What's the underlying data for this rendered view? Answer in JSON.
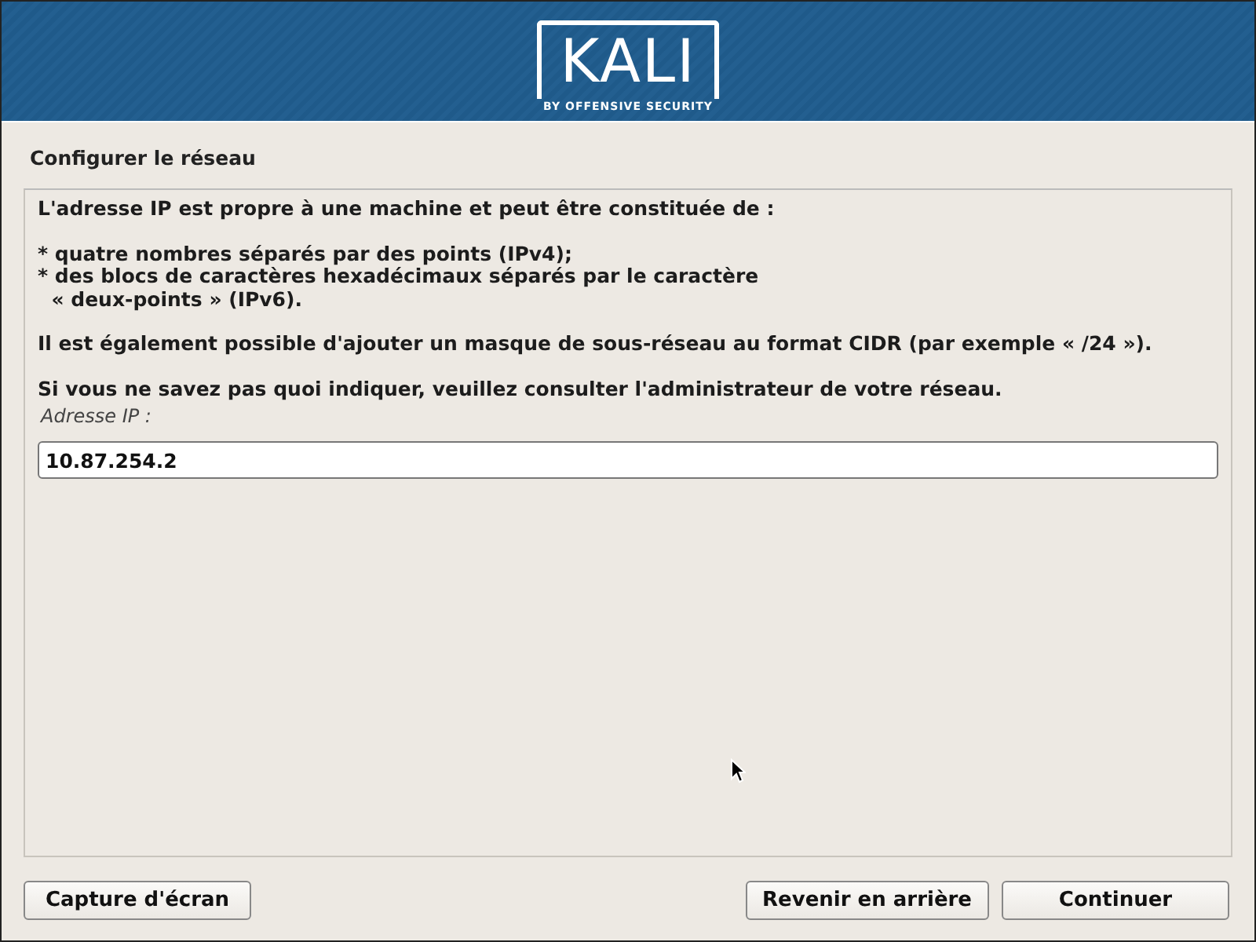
{
  "banner": {
    "logo_text": "KALI",
    "logo_tagline": "BY OFFENSIVE SECURITY"
  },
  "title": "Configurer le réseau",
  "intro": "L'adresse IP est propre à une machine et peut être constituée de :",
  "bullets": [
    {
      "text": "* quatre nombres séparés par des points (IPv4);"
    },
    {
      "text": "* des blocs de caractères hexadécimaux séparés par le caractère\n  « deux-points » (IPv6)."
    }
  ],
  "paragraphs": [
    "Il est également possible d'ajouter un masque de sous-réseau au format CIDR (par exemple « /24 »).",
    "Si vous ne savez pas quoi indiquer, veuillez consulter l'administrateur de votre réseau."
  ],
  "field": {
    "label": "Adresse IP :",
    "value": "10.87.254.2"
  },
  "buttons": [
    {
      "kind": "left",
      "label": "Capture d'écran"
    },
    {
      "kind": "right",
      "label": "Revenir en arrière"
    },
    {
      "kind": "right",
      "label": "Continuer"
    }
  ]
}
